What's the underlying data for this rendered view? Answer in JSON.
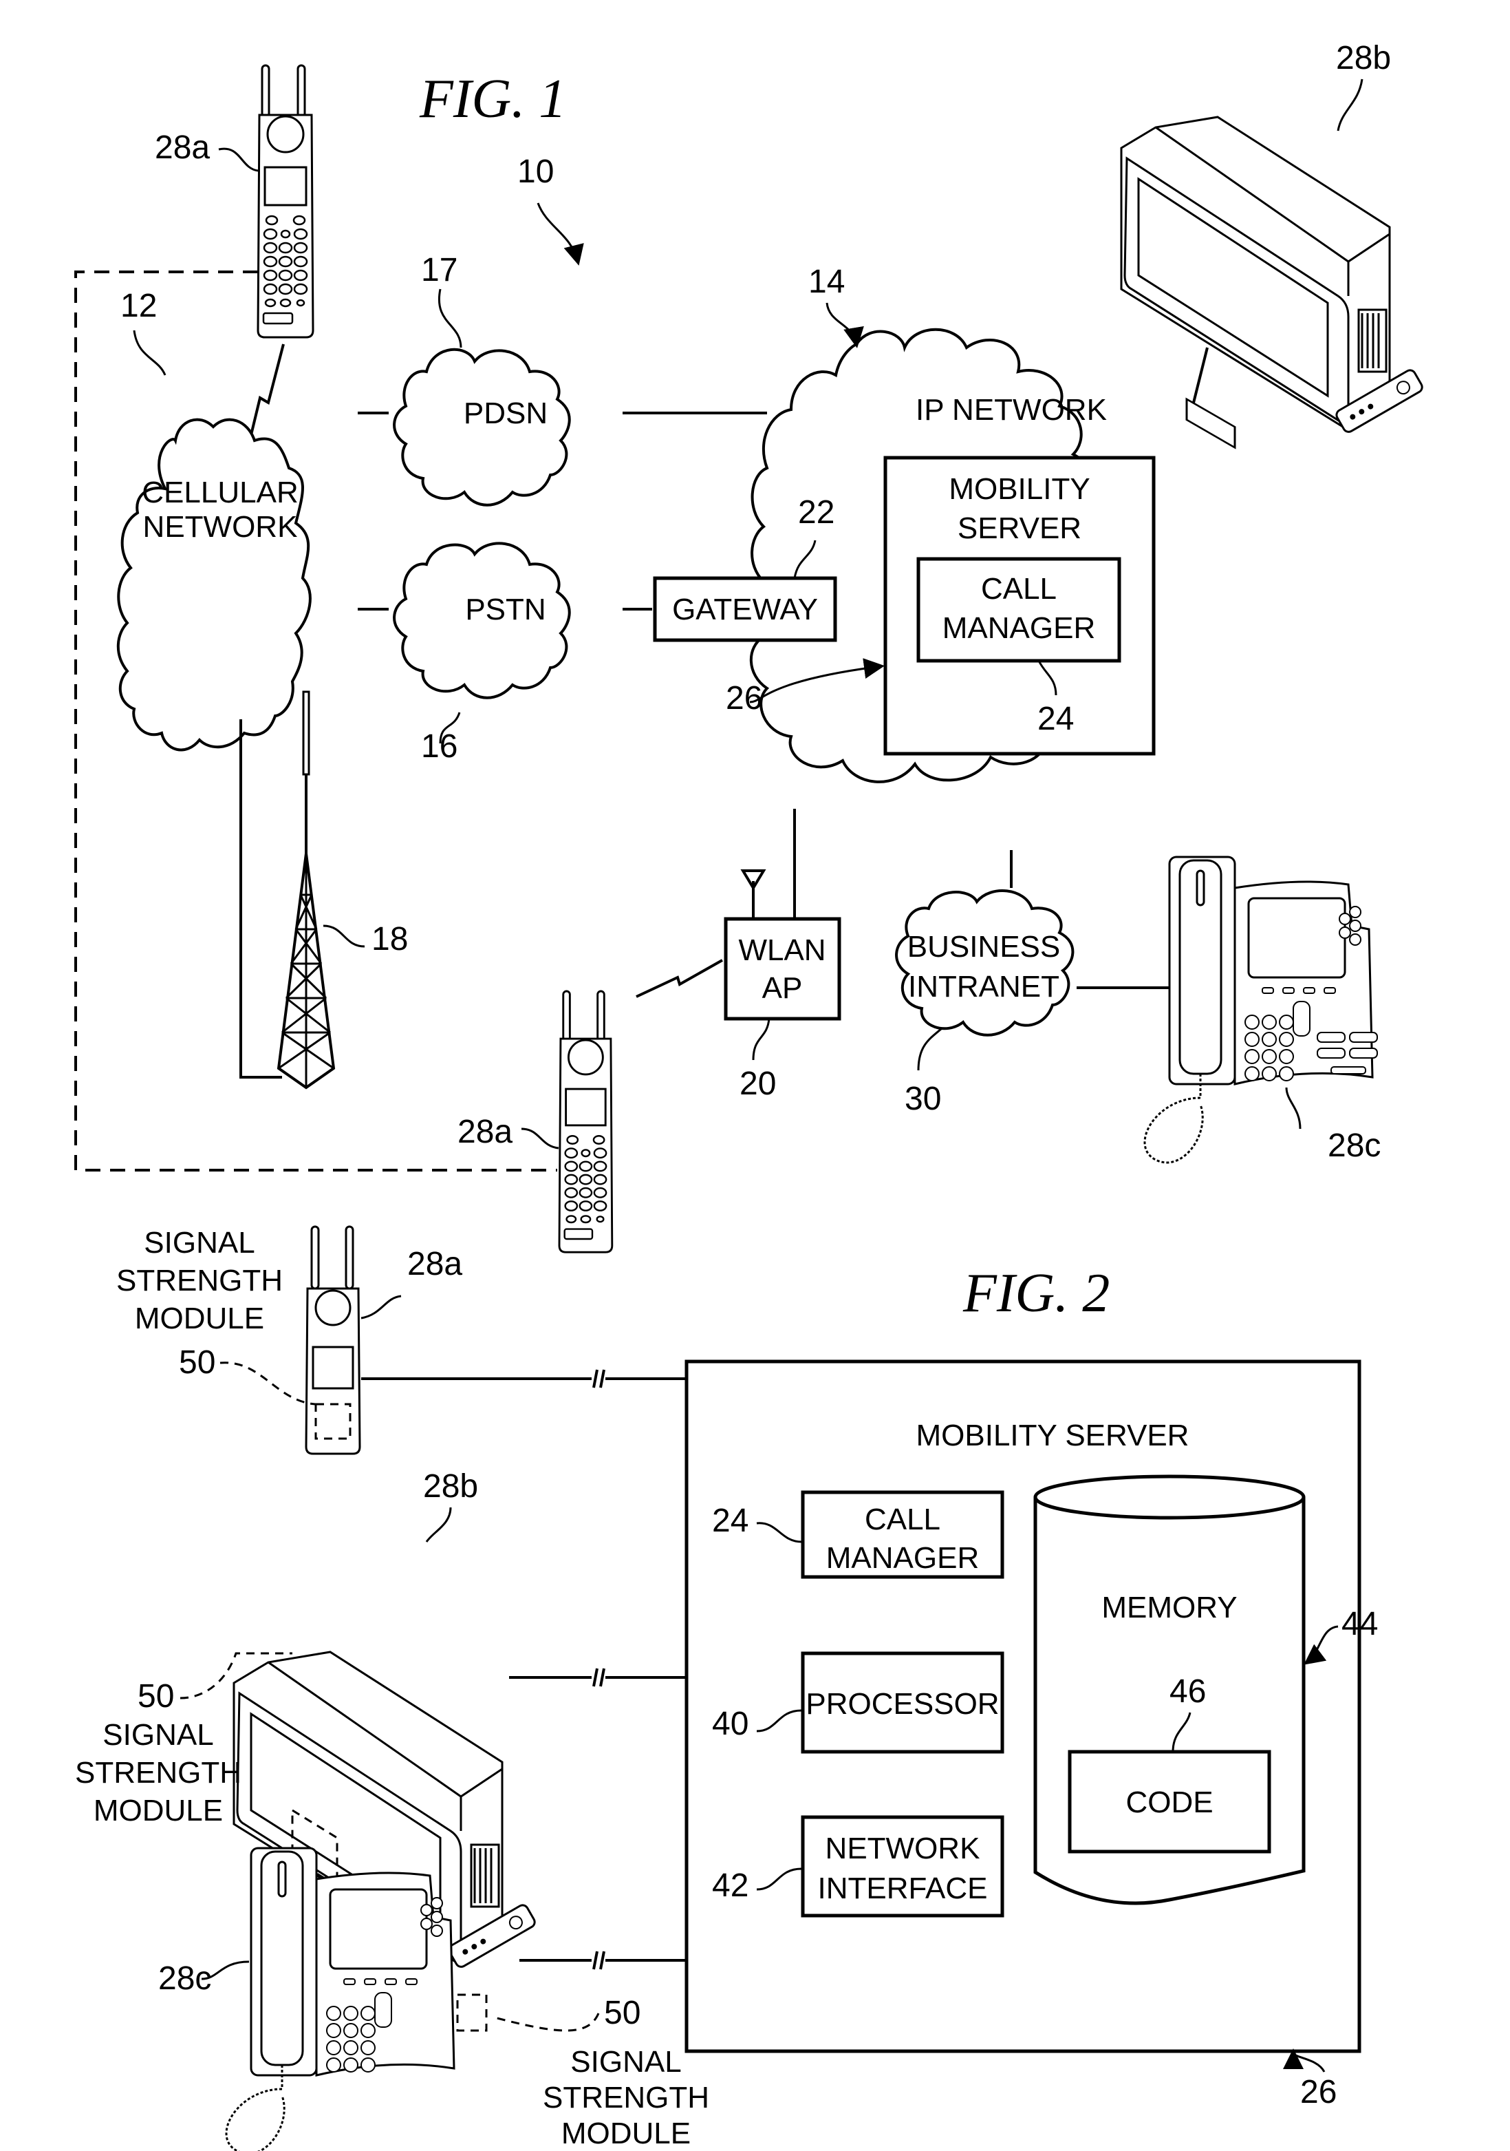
{
  "fig1": {
    "title": "FIG. 1",
    "system_ref": "10",
    "cellular_network": {
      "ref": "12",
      "line1": "CELLULAR",
      "line2": "NETWORK"
    },
    "pdsn": {
      "ref": "17",
      "label": "PDSN"
    },
    "pstn": {
      "ref": "16",
      "label": "PSTN"
    },
    "ip_network": {
      "ref": "14",
      "label": "IP NETWORK"
    },
    "gateway": {
      "ref": "22",
      "label": "GATEWAY"
    },
    "mobility_server": {
      "ref": "26",
      "line1": "MOBILITY",
      "line2": "SERVER"
    },
    "call_manager": {
      "ref": "24",
      "line1": "CALL",
      "line2": "MANAGER"
    },
    "tower": {
      "ref": "18"
    },
    "wlan_ap": {
      "ref": "20",
      "line1": "WLAN",
      "line2": "AP"
    },
    "business_intranet": {
      "ref": "30",
      "line1": "BUSINESS",
      "line2": "INTRANET"
    },
    "mobile_phone_top": {
      "ref": "28a"
    },
    "mobile_phone_bottom": {
      "ref": "28a"
    },
    "television": {
      "ref": "28b"
    },
    "ip_phone": {
      "ref": "28c"
    }
  },
  "fig2": {
    "title": "FIG. 2",
    "server_label": "MOBILITY SERVER",
    "server_ref": "26",
    "call_manager": {
      "ref": "24",
      "line1": "CALL",
      "line2": "MANAGER"
    },
    "processor": {
      "ref": "40",
      "label": "PROCESSOR"
    },
    "network_interface": {
      "ref": "42",
      "line1": "NETWORK",
      "line2": "INTERFACE"
    },
    "memory": {
      "ref": "44",
      "label": "MEMORY"
    },
    "code": {
      "ref": "46",
      "label": "CODE"
    },
    "mobile_phone": {
      "ref": "28a",
      "module_ref": "50",
      "module_lines": [
        "SIGNAL",
        "STRENGTH",
        "MODULE"
      ]
    },
    "television": {
      "ref": "28b",
      "module_ref": "50",
      "module_lines": [
        "SIGNAL",
        "STRENGTH",
        "MODULE"
      ]
    },
    "ip_phone": {
      "ref": "28c",
      "module_ref": "50",
      "module_lines": [
        "SIGNAL",
        "STRENGTH",
        "MODULE"
      ]
    }
  }
}
